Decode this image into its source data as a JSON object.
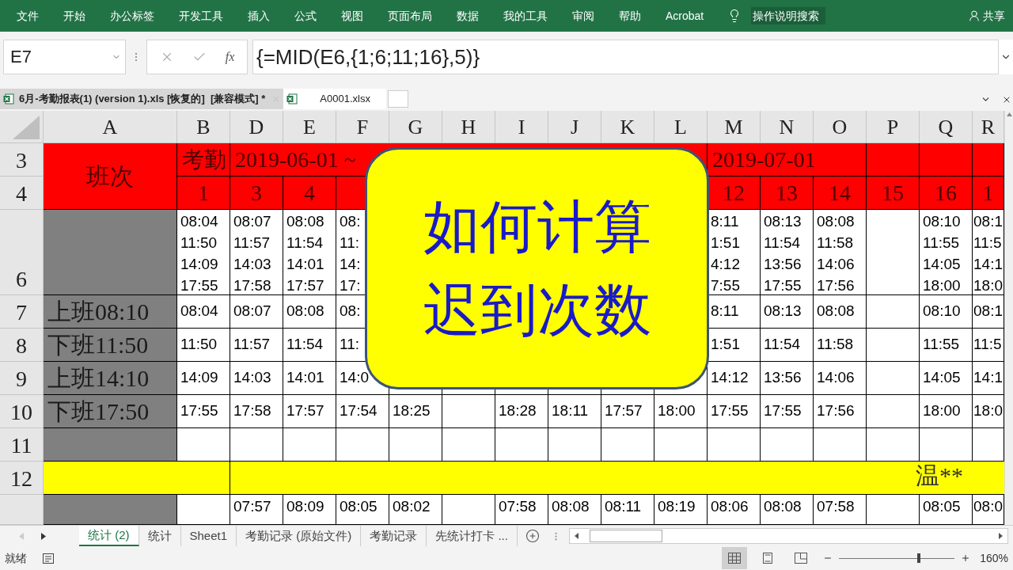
{
  "menu": [
    "文件",
    "开始",
    "办公标签",
    "开发工具",
    "插入",
    "公式",
    "视图",
    "页面布局",
    "数据",
    "我的工具",
    "审阅",
    "帮助",
    "Acrobat"
  ],
  "search": {
    "placeholder": "操作说明搜索"
  },
  "share": "共享",
  "formula_bar": {
    "name_box": "E7",
    "fx": "fx",
    "formula": "{=MID(E6,{1;6;11;16},5)}"
  },
  "workbooks": [
    {
      "name": "6月-考勤报表(1) (version 1).xls [恢复的]  [兼容模式] *",
      "selected": true
    },
    {
      "name": "A0001.xlsx",
      "selected": false
    }
  ],
  "sheet": {
    "columns": [
      "A",
      "B",
      "D",
      "E",
      "F",
      "G",
      "H",
      "I",
      "J",
      "K",
      "L",
      "M",
      "N",
      "O",
      "P",
      "Q",
      "R"
    ],
    "band": {
      "numbers": [
        "3",
        "4"
      ],
      "label": "班次",
      "title": [
        {
          "kind": "text",
          "text": "考勤"
        },
        {
          "kind": "text",
          "text": "2019-06-01 ~"
        },
        {
          "kind": "text",
          "text": "2019-07-01"
        },
        {
          "kind": "empty"
        },
        {
          "kind": "empty"
        },
        {
          "kind": "empty"
        }
      ],
      "days": [
        {
          "kind": "text",
          "text": "1"
        },
        {
          "kind": "text",
          "text": "3"
        },
        {
          "kind": "text",
          "text": "4"
        },
        {
          "kind": "empty"
        },
        {
          "kind": "empty"
        },
        {
          "kind": "empty"
        },
        {
          "kind": "empty"
        },
        {
          "kind": "empty"
        },
        {
          "kind": "empty"
        },
        {
          "kind": "empty"
        },
        {
          "kind": "text",
          "text": "12"
        },
        {
          "kind": "text",
          "text": "13"
        },
        {
          "kind": "text",
          "text": "14"
        },
        {
          "kind": "text",
          "text": "15"
        },
        {
          "kind": "text",
          "text": "16"
        },
        {
          "kind": "text",
          "text": "1"
        }
      ]
    },
    "rows": [
      {
        "number": "6",
        "kind": "punches",
        "cells": [
          {
            "kind": "lines",
            "lines": [
              "08:04",
              "11:50",
              "14:09",
              "17:55"
            ]
          },
          {
            "kind": "lines",
            "lines": [
              "08:07",
              "11:57",
              "14:03",
              "17:58"
            ]
          },
          {
            "kind": "lines",
            "lines": [
              "08:08",
              "11:54",
              "14:01",
              "17:57"
            ]
          },
          {
            "kind": "lines",
            "lines": [
              "08:",
              "11:",
              "14:",
              "17:"
            ]
          },
          {
            "kind": "empty"
          },
          {
            "kind": "empty"
          },
          {
            "kind": "empty"
          },
          {
            "kind": "empty"
          },
          {
            "kind": "empty"
          },
          {
            "kind": "empty"
          },
          {
            "kind": "lines",
            "lines": [
              "8:11",
              "1:51",
              "4:12",
              "7:55"
            ]
          },
          {
            "kind": "lines",
            "lines": [
              "08:13",
              "11:54",
              "13:56",
              "17:55"
            ]
          },
          {
            "kind": "lines",
            "lines": [
              "08:08",
              "11:58",
              "14:06",
              "17:56"
            ]
          },
          {
            "kind": "empty"
          },
          {
            "kind": "lines",
            "lines": [
              "08:10",
              "11:55",
              "14:05",
              "18:00"
            ]
          },
          {
            "kind": "lines",
            "lines": [
              "08:1",
              "11:5",
              "14:1",
              "18:0"
            ]
          }
        ]
      },
      {
        "number": "7",
        "kind": "time",
        "label": "上班08:10",
        "cells": [
          {
            "kind": "text",
            "text": "08:04"
          },
          {
            "kind": "text",
            "text": "08:07"
          },
          {
            "kind": "text",
            "text": "08:08"
          },
          {
            "kind": "text",
            "text": "08:"
          },
          {
            "kind": "empty"
          },
          {
            "kind": "empty"
          },
          {
            "kind": "empty"
          },
          {
            "kind": "empty"
          },
          {
            "kind": "empty"
          },
          {
            "kind": "empty"
          },
          {
            "kind": "text",
            "text": "8:11"
          },
          {
            "kind": "text",
            "text": "08:13"
          },
          {
            "kind": "text",
            "text": "08:08"
          },
          {
            "kind": "empty"
          },
          {
            "kind": "text",
            "text": "08:10"
          },
          {
            "kind": "text",
            "text": "08:1"
          }
        ]
      },
      {
        "number": "8",
        "kind": "time",
        "label": "下班11:50",
        "cells": [
          {
            "kind": "text",
            "text": "11:50"
          },
          {
            "kind": "text",
            "text": "11:57"
          },
          {
            "kind": "text",
            "text": "11:54"
          },
          {
            "kind": "text",
            "text": "11:"
          },
          {
            "kind": "empty"
          },
          {
            "kind": "empty"
          },
          {
            "kind": "empty"
          },
          {
            "kind": "empty"
          },
          {
            "kind": "empty"
          },
          {
            "kind": "empty"
          },
          {
            "kind": "text",
            "text": "1:51"
          },
          {
            "kind": "text",
            "text": "11:54"
          },
          {
            "kind": "text",
            "text": "11:58"
          },
          {
            "kind": "empty"
          },
          {
            "kind": "text",
            "text": "11:55"
          },
          {
            "kind": "text",
            "text": "11:5"
          }
        ]
      },
      {
        "number": "9",
        "kind": "time",
        "label": "上班14:10",
        "cells": [
          {
            "kind": "text",
            "text": "14:09"
          },
          {
            "kind": "text",
            "text": "14:03"
          },
          {
            "kind": "text",
            "text": "14:01"
          },
          {
            "kind": "text",
            "text": "14:0"
          },
          {
            "kind": "empty"
          },
          {
            "kind": "empty"
          },
          {
            "kind": "empty"
          },
          {
            "kind": "empty"
          },
          {
            "kind": "empty"
          },
          {
            "kind": "empty"
          },
          {
            "kind": "text",
            "text": "14:12"
          },
          {
            "kind": "text",
            "text": "13:56"
          },
          {
            "kind": "text",
            "text": "14:06"
          },
          {
            "kind": "empty"
          },
          {
            "kind": "text",
            "text": "14:05"
          },
          {
            "kind": "text",
            "text": "14:1"
          }
        ]
      },
      {
        "number": "10",
        "kind": "time",
        "label": "下班17:50",
        "cells": [
          {
            "kind": "text",
            "text": "17:55"
          },
          {
            "kind": "text",
            "text": "17:58"
          },
          {
            "kind": "text",
            "text": "17:57"
          },
          {
            "kind": "text",
            "text": "17:54"
          },
          {
            "kind": "text",
            "text": "18:25"
          },
          {
            "kind": "empty"
          },
          {
            "kind": "text",
            "text": "18:28"
          },
          {
            "kind": "text",
            "text": "18:11"
          },
          {
            "kind": "text",
            "text": "17:57"
          },
          {
            "kind": "text",
            "text": "18:00"
          },
          {
            "kind": "text",
            "text": "17:55"
          },
          {
            "kind": "text",
            "text": "17:55"
          },
          {
            "kind": "text",
            "text": "17:56"
          },
          {
            "kind": "empty"
          },
          {
            "kind": "text",
            "text": "18:00"
          },
          {
            "kind": "text",
            "text": "18:0"
          }
        ]
      },
      {
        "number": "11",
        "kind": "time"
      },
      {
        "number": "12",
        "kind": "name_band",
        "name": "温**"
      },
      {
        "kind": "punches",
        "cells": [
          {
            "kind": "empty"
          },
          {
            "kind": "lines",
            "lines": [
              "07:57"
            ]
          },
          {
            "kind": "lines",
            "lines": [
              "08:09"
            ]
          },
          {
            "kind": "lines",
            "lines": [
              "08:05"
            ]
          },
          {
            "kind": "lines",
            "lines": [
              "08:02"
            ]
          },
          {
            "kind": "empty"
          },
          {
            "kind": "lines",
            "lines": [
              "07:58"
            ]
          },
          {
            "kind": "lines",
            "lines": [
              "08:08"
            ]
          },
          {
            "kind": "lines",
            "lines": [
              "08:11"
            ]
          },
          {
            "kind": "lines",
            "lines": [
              "08:19"
            ]
          },
          {
            "kind": "lines",
            "lines": [
              "08:06"
            ]
          },
          {
            "kind": "lines",
            "lines": [
              "08:08"
            ]
          },
          {
            "kind": "lines",
            "lines": [
              "07:58"
            ]
          },
          {
            "kind": "empty"
          },
          {
            "kind": "lines",
            "lines": [
              "08:05"
            ]
          },
          {
            "kind": "lines",
            "lines": [
              "08:0"
            ]
          }
        ]
      }
    ]
  },
  "title_card": {
    "lines": [
      "如何计算",
      "迟到次数"
    ]
  },
  "sheet_tabs": [
    {
      "label": "统计 (2)",
      "selected": true
    },
    {
      "label": "统计",
      "selected": false
    },
    {
      "label": "Sheet1",
      "selected": false
    },
    {
      "label": "考勤记录 (原始文件)",
      "selected": false
    },
    {
      "label": "考勤记录",
      "selected": false
    },
    {
      "label": "先统计打卡 ...",
      "selected": false
    }
  ],
  "status": "就绪",
  "view_buttons": [
    {
      "kind": "normal",
      "selected": true
    },
    {
      "kind": "page_layout",
      "selected": false
    },
    {
      "kind": "page_break",
      "selected": false
    }
  ],
  "zoom": {
    "level": 0.68,
    "label": "160%"
  }
}
